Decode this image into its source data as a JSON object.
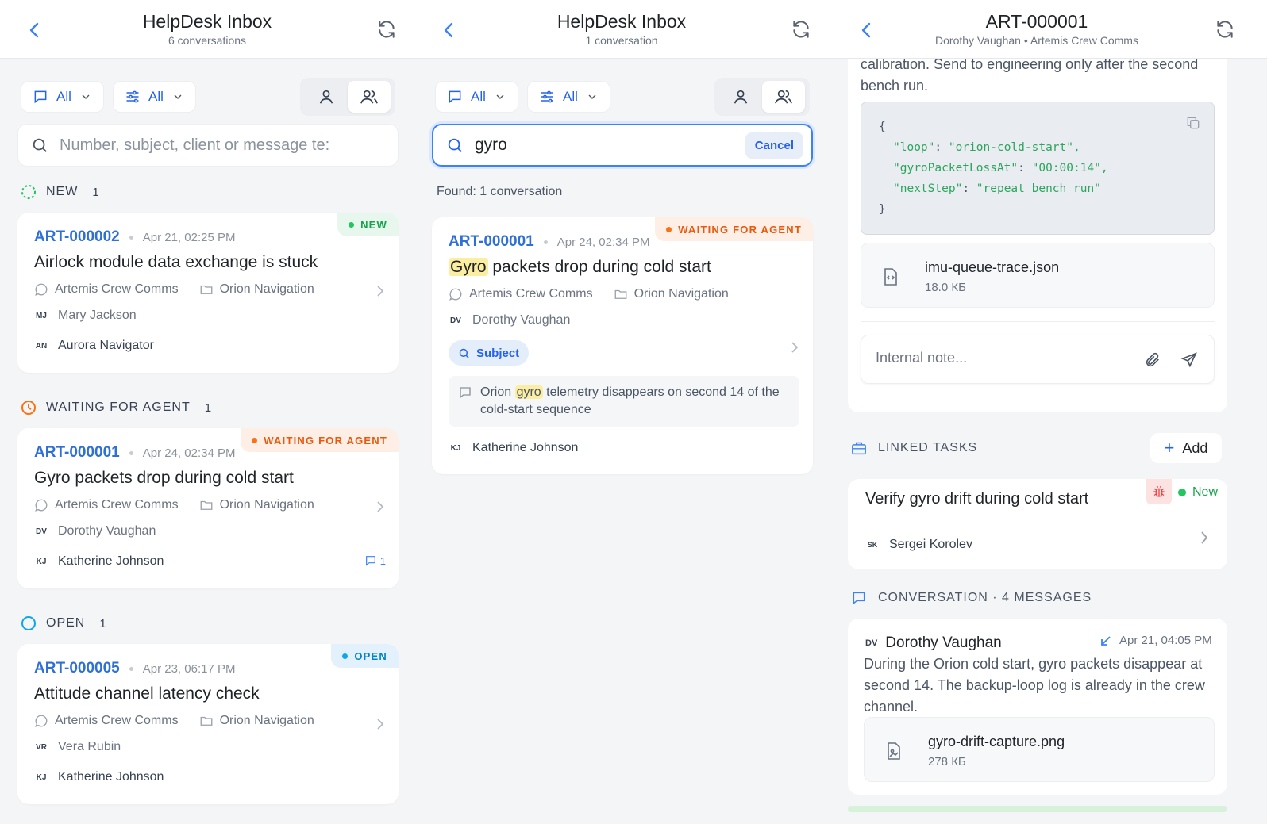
{
  "panel1": {
    "title": "HelpDesk Inbox",
    "subtitle": "6 conversations",
    "filter_channel": "All",
    "filter_props": "All",
    "search_placeholder": "Number, subject, client or message te:",
    "sections": [
      {
        "label": "NEW",
        "count": "1"
      },
      {
        "label": "WAITING FOR AGENT",
        "count": "1"
      },
      {
        "label": "OPEN",
        "count": "1"
      }
    ],
    "cards": [
      {
        "badge": "NEW",
        "id": "ART-000002",
        "date": "Apr 21, 02:25 PM",
        "subject": "Airlock module data exchange is stuck",
        "client": "Artemis Crew Comms",
        "project": "Orion Navigation",
        "requester_initials": "MJ",
        "requester": "Mary Jackson",
        "assignee_initials": "AN",
        "assignee": "Aurora Navigator"
      },
      {
        "badge": "WAITING FOR AGENT",
        "id": "ART-000001",
        "date": "Apr 24, 02:34 PM",
        "subject": "Gyro packets drop during cold start",
        "client": "Artemis Crew Comms",
        "project": "Orion Navigation",
        "requester_initials": "DV",
        "requester": "Dorothy Vaughan",
        "assignee_initials": "KJ",
        "assignee": "Katherine Johnson",
        "messages": "1"
      },
      {
        "badge": "OPEN",
        "id": "ART-000005",
        "date": "Apr 23, 06:17 PM",
        "subject": "Attitude channel latency check",
        "client": "Artemis Crew Comms",
        "project": "Orion Navigation",
        "requester_initials": "VR",
        "requester": "Vera Rubin",
        "assignee_initials": "KJ",
        "assignee": "Katherine Johnson"
      }
    ]
  },
  "panel2": {
    "title": "HelpDesk Inbox",
    "subtitle": "1 conversation",
    "filter_channel": "All",
    "filter_props": "All",
    "search_value": "gyro",
    "cancel_label": "Cancel",
    "found": "Found: 1 conversation",
    "card": {
      "badge": "WAITING FOR AGENT",
      "id": "ART-000001",
      "date": "Apr 24, 02:34 PM",
      "subject_highlight": "Gyro",
      "subject_rest": "packets drop during cold start",
      "client": "Artemis Crew Comms",
      "project": "Orion Navigation",
      "requester_initials": "DV",
      "requester": "Dorothy Vaughan",
      "match_chip": "Subject",
      "snippet_pre": "Orion",
      "snippet_highlight": "gyro",
      "snippet_post": "telemetry disappears on second 14 of the cold-start sequence",
      "assignee_initials": "KJ",
      "assignee": "Katherine Johnson"
    }
  },
  "panel3": {
    "title": "ART-000001",
    "subtitle": "Dorothy Vaughan • Artemis Crew Comms",
    "top_text": "calibration. Send to engineering only after the second bench run.",
    "code": {
      "open": "{",
      "lines": [
        {
          "key": "\"loop\"",
          "value": "\"orion-cold-start\","
        },
        {
          "key": "\"gyroPacketLossAt\"",
          "value": "\"00:00:14\","
        },
        {
          "key": "\"nextStep\"",
          "value": "\"repeat bench run\""
        }
      ],
      "close": "}"
    },
    "attachment1": {
      "name": "imu-queue-trace.json",
      "size": "18.0 КБ"
    },
    "note_placeholder": "Internal note...",
    "linked_tasks_label": "LINKED TASKS",
    "add_label": "Add",
    "task": {
      "title": "Verify gyro drift during cold start",
      "status": "New",
      "assignee_initials": "SK",
      "assignee": "Sergei Korolev"
    },
    "conversation_label": "CONVERSATION · 4 MESSAGES",
    "message": {
      "initials": "DV",
      "author": "Dorothy Vaughan",
      "date": "Apr 21, 04:05 PM",
      "body": "During the Orion cold start, gyro packets disappear at second 14. The backup-loop log is already in the crew channel.",
      "attachment_name": "gyro-drift-capture.png",
      "attachment_size": "278 КБ"
    }
  },
  "colors": {
    "accent": "#2563eb",
    "new": "#16a34a",
    "waiting": "#ea580c",
    "open": "#0284c7"
  }
}
